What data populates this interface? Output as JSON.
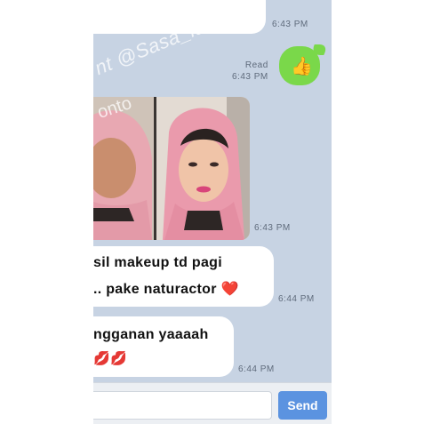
{
  "messages": [
    {
      "id": "m1",
      "time": "6:43 PM"
    },
    {
      "id": "m2",
      "status": "Read",
      "time": "6:43 PM",
      "content": "👍"
    },
    {
      "id": "m3",
      "time": "6:43 PM"
    },
    {
      "id": "m4",
      "line1": "sil makeup td pagi",
      "line2": ".. pake naturactor ❤️",
      "time": "6:44 PM"
    },
    {
      "id": "m5",
      "line1": "ngganan yaaaah",
      "line2": "💋💋",
      "time": "6:44 PM"
    }
  ],
  "watermark": "nt @Sasa_lashes",
  "photo_watermark": "onto",
  "composer": {
    "input_value": "",
    "send_label": "Send"
  },
  "colors": {
    "chat_bg": "#c7d3e3",
    "outgoing": "#7ad84a",
    "send": "#5b93e0"
  }
}
